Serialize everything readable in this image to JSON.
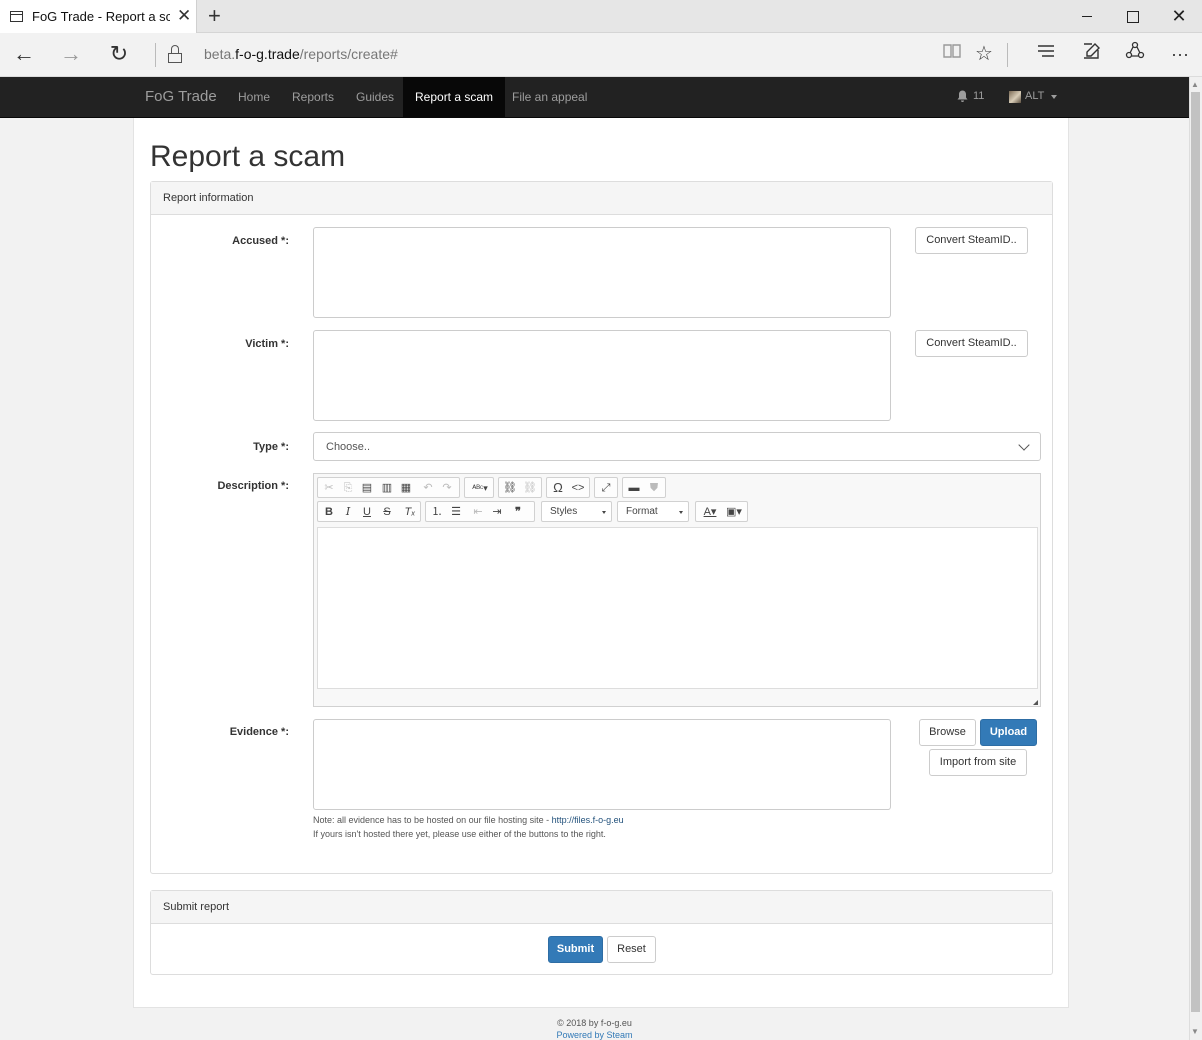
{
  "browser": {
    "tab_title": "FoG Trade - Report a scam",
    "url_prefix": "beta.",
    "url_domain": "f-o-g.trade",
    "url_path": "/reports/create#"
  },
  "navbar": {
    "brand": "FoG Trade",
    "links": [
      {
        "label": "Home",
        "active": false
      },
      {
        "label": "Reports",
        "active": false
      },
      {
        "label": "Guides",
        "active": false
      },
      {
        "label": "Report a scam",
        "active": true
      },
      {
        "label": "File an appeal",
        "active": false
      }
    ],
    "notification_count": "11",
    "user": "ALT"
  },
  "page": {
    "title": "Report a scam"
  },
  "info_panel": {
    "heading": "Report information",
    "accused_label": "Accused *:",
    "victim_label": "Victim *:",
    "type_label": "Type *:",
    "description_label": "Description *:",
    "evidence_label": "Evidence *:",
    "convert_button": "Convert SteamID..",
    "type_value": "Choose..",
    "editor": {
      "styles_combo": "Styles",
      "format_combo": "Format"
    },
    "browse_button": "Browse",
    "upload_button": "Upload",
    "import_button": "Import from site",
    "note_line1": "Note: all evidence has to be hosted on our file hosting site - ",
    "note_link": "http://files.f-o-g.eu",
    "note_line2": "If yours isn't hosted there yet, please use either of the buttons to the right."
  },
  "submit_panel": {
    "heading": "Submit report",
    "submit_button": "Submit",
    "reset_button": "Reset"
  },
  "footer": {
    "copyright": "© 2018 by f-o-g.eu",
    "powered": "Powered by Steam"
  },
  "colors": {
    "navbar_bg": "#222222",
    "primary": "#337ab7"
  }
}
